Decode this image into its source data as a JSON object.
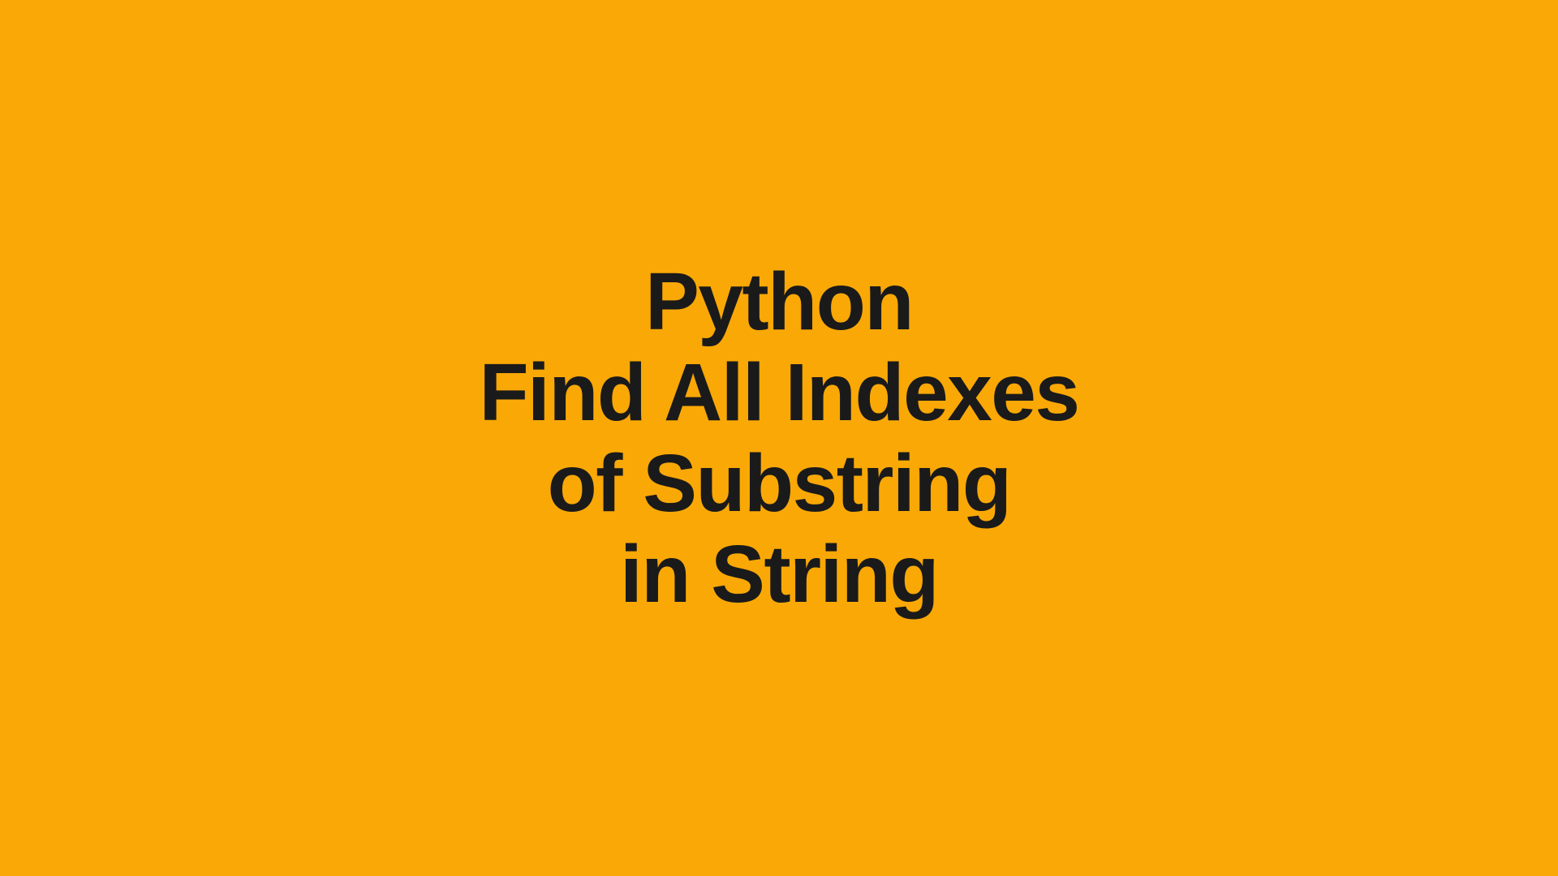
{
  "title": {
    "line1": "Python",
    "line2": "Find All Indexes",
    "line3": "of Substring",
    "line4": "in String"
  },
  "colors": {
    "background": "#f9a806",
    "text": "#1a1a1a"
  }
}
